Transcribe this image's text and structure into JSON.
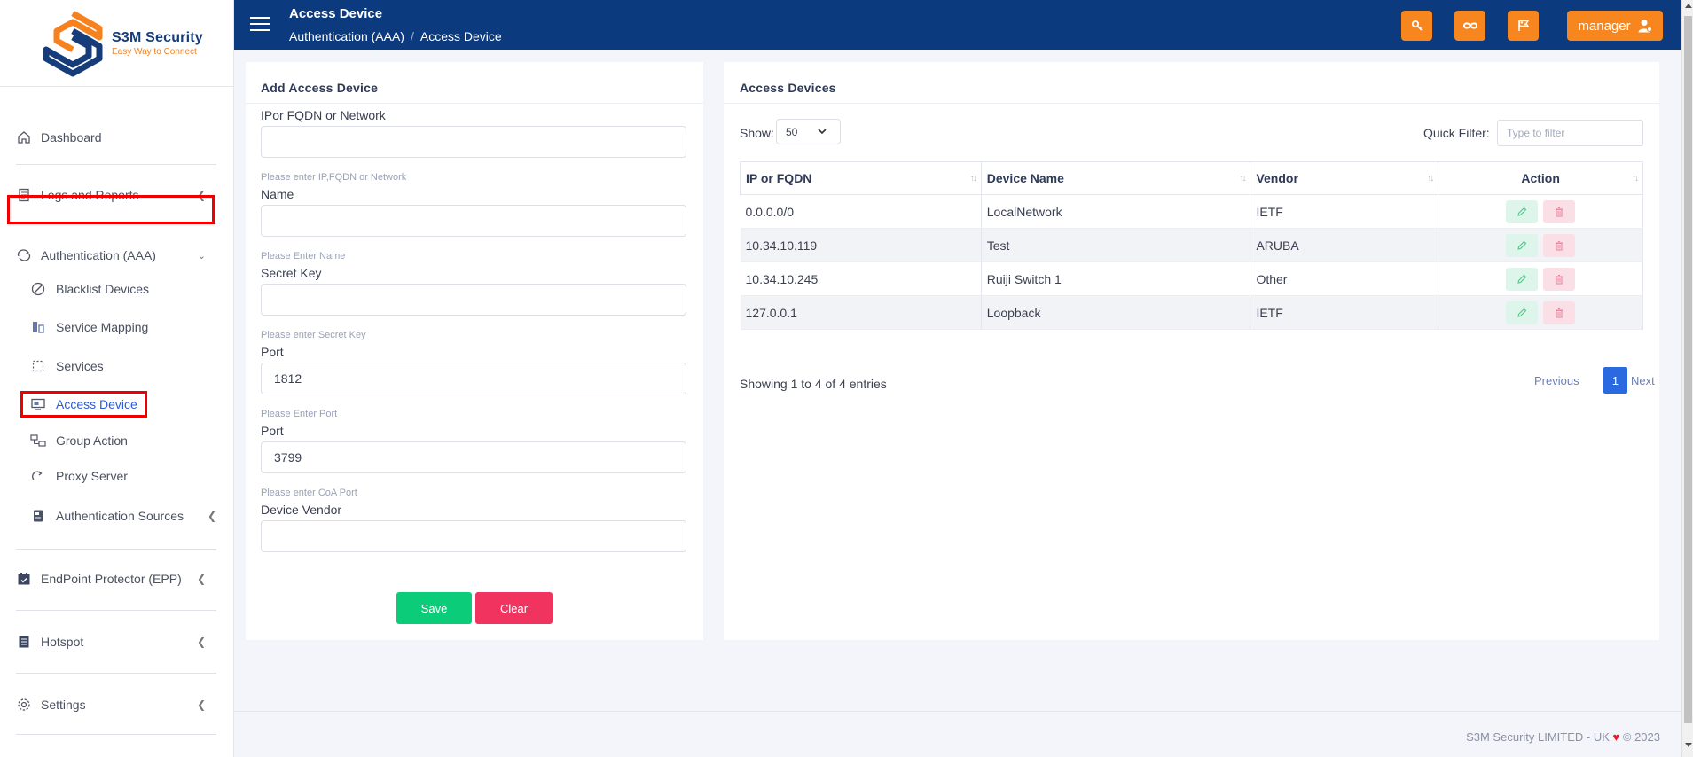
{
  "brand": {
    "name": "S3M Security",
    "tagline": "Easy Way to Connect",
    "primary_color": "#0c3a7e",
    "accent_color": "#f7861e"
  },
  "header": {
    "title": "Access Device",
    "breadcrumb": [
      "Authentication (AAA)",
      "Access Device"
    ],
    "icons": [
      "key-icon",
      "infinity-icon",
      "flag-icon"
    ],
    "user_label": "manager"
  },
  "sidebar": {
    "items": [
      {
        "label": "Dashboard",
        "icon": "home-icon"
      },
      {
        "label": "Logs and Reports",
        "icon": "report-icon"
      },
      {
        "label": "Authentication (AAA)",
        "icon": "sync-icon",
        "expanded": true
      },
      {
        "label": "EndPoint Protector (EPP)",
        "icon": "calendar-check-icon"
      },
      {
        "label": "Hotspot",
        "icon": "book-icon"
      },
      {
        "label": "Settings",
        "icon": "gear-icon"
      }
    ],
    "sub_items": [
      {
        "label": "Blacklist Devices",
        "icon": "block-icon"
      },
      {
        "label": "Service Mapping",
        "icon": "mapping-icon"
      },
      {
        "label": "Services",
        "icon": "dashed-square-icon"
      },
      {
        "label": "Access Device",
        "icon": "monitor-icon",
        "active": true
      },
      {
        "label": "Group Action",
        "icon": "network-icon"
      },
      {
        "label": "Proxy Server",
        "icon": "redirect-icon"
      },
      {
        "label": "Authentication Sources",
        "icon": "source-icon"
      }
    ]
  },
  "form": {
    "title": "Add Access Device",
    "fields": [
      {
        "label": "IPor FQDN or Network",
        "value": "",
        "help": "Please enter IP,FQDN or Network"
      },
      {
        "label": "Name",
        "value": "",
        "help": "Please Enter Name"
      },
      {
        "label": "Secret Key",
        "value": "",
        "help": "Please enter Secret Key"
      },
      {
        "label": "Port",
        "value": "1812",
        "help": "Please Enter Port"
      },
      {
        "label": "Port",
        "value": "3799",
        "help": "Please enter CoA Port"
      },
      {
        "label": "Device Vendor",
        "value": ""
      }
    ],
    "save_label": "Save",
    "clear_label": "Clear"
  },
  "table": {
    "title": "Access Devices",
    "show_label": "Show:",
    "page_size": "50",
    "quick_filter_label": "Quick Filter:",
    "quick_filter_placeholder": "Type to filter",
    "columns": [
      "IP or FQDN",
      "Device Name",
      "Vendor",
      "Action"
    ],
    "rows": [
      [
        "0.0.0.0/0",
        "LocalNetwork",
        "IETF"
      ],
      [
        "10.34.10.119",
        "Test",
        "ARUBA"
      ],
      [
        "10.34.10.245",
        "Ruiji Switch 1",
        "Other"
      ],
      [
        "127.0.0.1",
        "Loopback",
        "IETF"
      ]
    ],
    "summary": "Showing 1 to 4 of 4 entries",
    "pagination": {
      "previous": "Previous",
      "current": "1",
      "next": "Next"
    }
  },
  "footer": {
    "text": "S3M Security LIMITED - UK",
    "year": "© 2023"
  }
}
